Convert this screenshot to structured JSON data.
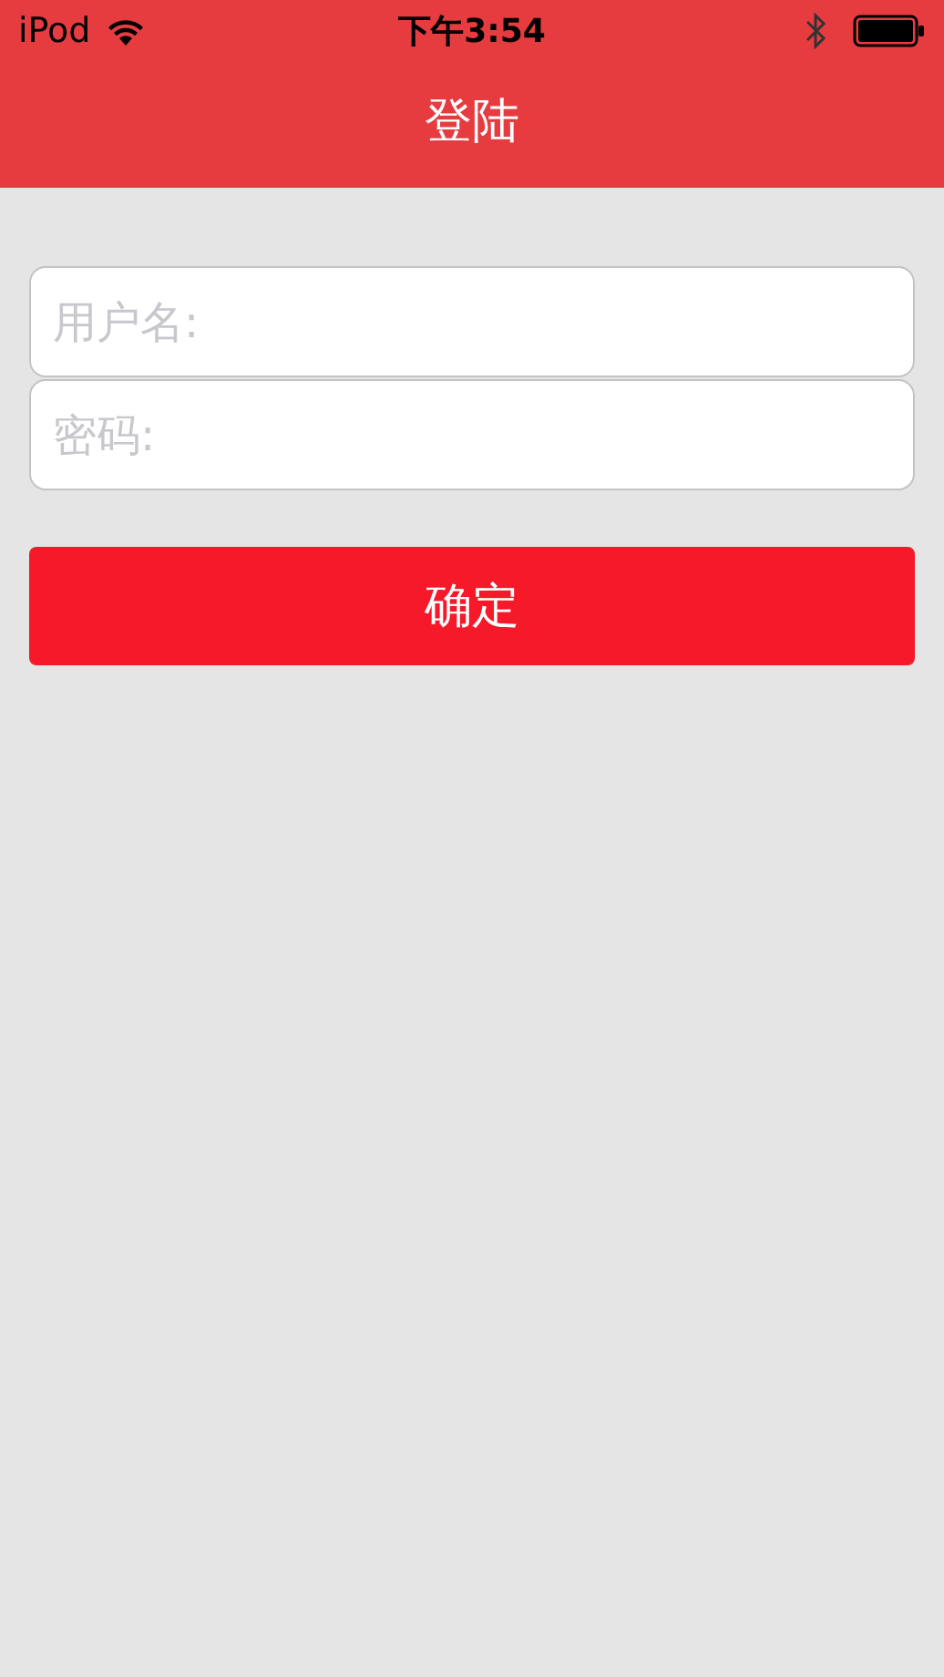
{
  "status_bar": {
    "carrier": "iPod",
    "time": "下午3:54"
  },
  "nav_bar": {
    "title": "登陆"
  },
  "fields": [
    {
      "placeholder": "用户名:"
    },
    {
      "placeholder": "密码:"
    }
  ],
  "submit_button": {
    "label": "确定"
  }
}
